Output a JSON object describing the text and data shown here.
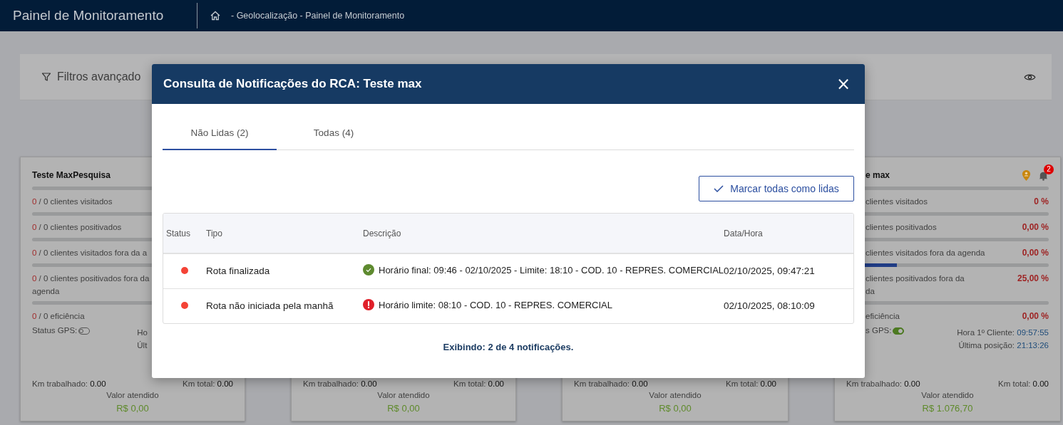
{
  "header": {
    "title": "Painel de Monitoramento",
    "breadcrumb": "- Geolocalização - Painel de Monitoramento"
  },
  "filter_panel": {
    "label": "Filtros avançado"
  },
  "cards": [
    {
      "title": "Teste MaxPesquisa",
      "metrics": [
        {
          "done": "0",
          "text": " / 0 clientes visitados",
          "level": 0
        },
        {
          "done": "0",
          "text": " / 0 clientes positivados",
          "level": 0
        },
        {
          "done": "0",
          "text": " / 0 clientes visitados fora da a",
          "level": 0
        },
        {
          "done": "0",
          "text": " / 0 clientes positivados fora da",
          "text_2": "agenda",
          "level": 0
        },
        {
          "done": "0",
          "text": " / 0 eficiência",
          "level": 0
        }
      ],
      "gps": {
        "label": "Status GPS:",
        "on": false
      },
      "times": [
        {
          "label": "Ho"
        },
        {
          "label": "Últ"
        }
      ],
      "km": [
        {
          "label": "Km trabalhado:",
          "value": "0.00"
        },
        {
          "label": "Km total:",
          "value": "0.00"
        }
      ],
      "value": {
        "label": "Valor atendido",
        "amount": "R$ 0,00"
      }
    },
    {
      "km": [
        {
          "label": "Km trabalhado:",
          "value": "0.00"
        },
        {
          "label": "Km total:",
          "value": "0.00"
        }
      ],
      "value": {
        "label": "Valor atendido",
        "amount": "R$ 0,00"
      }
    },
    {
      "km": [
        {
          "label": "Km trabalhado:",
          "value": "0.00"
        },
        {
          "label": "Km total:",
          "value": "0.00"
        }
      ],
      "value": {
        "label": "Valor atendido",
        "amount": "R$ 0,00"
      }
    },
    {
      "title": "e max",
      "notifications": "2",
      "metrics": [
        {
          "text": "clientes visitados",
          "percent": "0 %",
          "level": 0
        },
        {
          "text": "clientes positivados",
          "percent": "0,00 %",
          "level": 0
        },
        {
          "text": "clientes visitados fora da agenda",
          "percent": "0,00 %",
          "level": 0
        },
        {
          "text": "clientes positivados fora da",
          "text_2": "da",
          "percent": "25,00 %",
          "level": 0.25
        },
        {
          "text": "eficiência",
          "percent": "0,00 %",
          "level": 0
        }
      ],
      "gps": {
        "label": "s GPS:",
        "on": true
      },
      "times": [
        {
          "label": "Hora 1º Cliente:",
          "value": "09:57:55"
        },
        {
          "label": "Última posição:",
          "value": "21:13:26"
        }
      ],
      "km": [
        {
          "label": "Km trabalhado:",
          "value": "0.00"
        },
        {
          "label": "Km total:",
          "value": "0.00"
        }
      ],
      "value": {
        "label": "Valor atendido",
        "amount": "R$ 1.076,70"
      }
    }
  ],
  "modal": {
    "title": "Consulta de Notificações do RCA: Teste max",
    "close": "×",
    "tabs": [
      {
        "label": "Não Lidas (2)",
        "selected": true
      },
      {
        "label": "Todas (4)",
        "selected": false
      }
    ],
    "mark_all_button": "Marcar todas como lidas",
    "table": {
      "columns": [
        "Status",
        "Tipo",
        "Descrição",
        "Data/Hora"
      ],
      "rows": [
        {
          "color": "#f44336",
          "tipo": "Rota finalizada",
          "kind": "success",
          "descricao": "Horário final: 09:46 - 02/10/2025 - Limite: 18:10 - COD. 10 - REPRES. COMERCIAL",
          "data_hora": "02/10/2025, 09:47:21"
        },
        {
          "color": "#f44336",
          "tipo": "Rota não iniciada pela manhã",
          "kind": "error",
          "descricao": "Horário limite: 08:10 - COD. 10 - REPRES. COMERCIAL",
          "data_hora": "02/10/2025, 08:10:09"
        }
      ]
    },
    "footer": "Exibindo: 2 de 4 notificações."
  }
}
